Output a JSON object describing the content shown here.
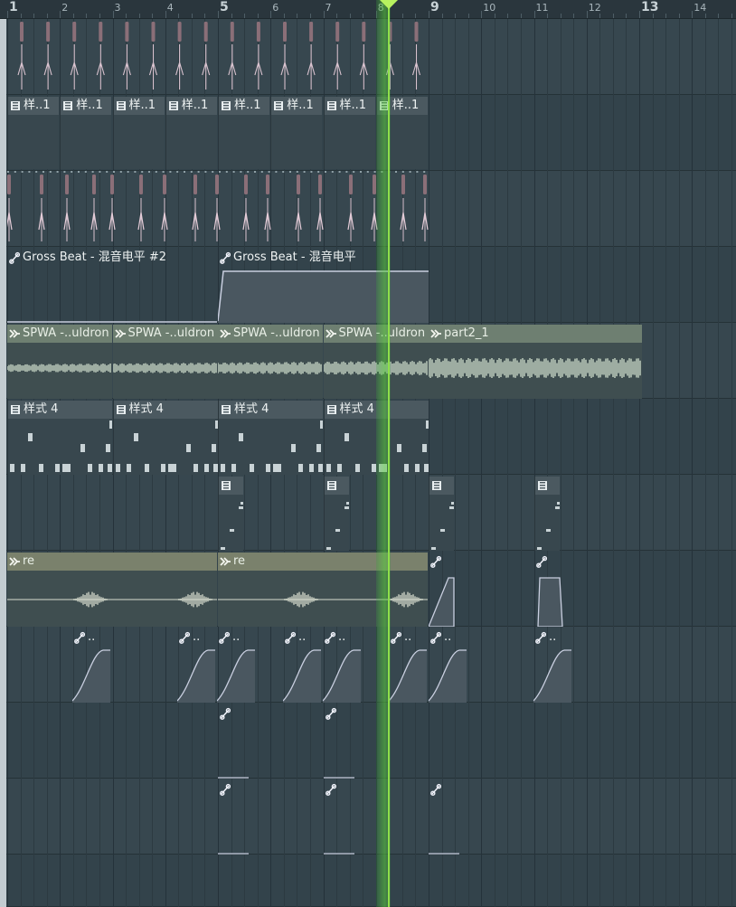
{
  "colors": {
    "background": "#34444d",
    "ruler": "#2a363d",
    "pattern_header": "#4b5960",
    "audio_header": "#6e7f71",
    "automation_header": "#59628a",
    "playhead": "#8ee04a",
    "waveform": "#c7d6c6"
  },
  "ruler": {
    "bars": [
      "1",
      "2",
      "3",
      "4",
      "5",
      "6",
      "7",
      "8",
      "9",
      "10",
      "11",
      "12",
      "13",
      "14"
    ],
    "major_bars": [
      "1",
      "5",
      "9",
      "13"
    ]
  },
  "playhead": {
    "bar": "8.2",
    "color": "#8ee04a"
  },
  "clips": {
    "row1": {
      "type": "pattern",
      "labels": []
    },
    "row2": {
      "type": "pattern",
      "labels": [
        "样..1",
        "样..1",
        "样..1",
        "样..1",
        "样..1",
        "样..1",
        "样..1",
        "样..1"
      ]
    },
    "row3": {
      "type": "pattern",
      "labels": []
    },
    "row4": {
      "type": "automation",
      "labels": [
        "Gross Beat - 混音电平 #2",
        "Gross Beat - 混音电平"
      ]
    },
    "row5": {
      "type": "audio",
      "labels": [
        "SPWA -..uldron",
        "SPWA -..uldron",
        "SPWA -..uldron",
        "SPWA -..uldron",
        "part2_1"
      ]
    },
    "row6": {
      "type": "pattern",
      "labels": [
        "样式 4",
        "样式 4",
        "样式 4",
        "样式 4"
      ]
    },
    "row7": {
      "type": "pattern",
      "labels": [
        "",
        "",
        "",
        ""
      ]
    },
    "row8": {
      "type": "audio",
      "labels": [
        "re",
        "re"
      ]
    },
    "row9": {
      "type": "automation",
      "labels": [
        "..",
        "..",
        "..",
        "..",
        "..",
        "..",
        "..",
        ".."
      ]
    },
    "row10": {
      "type": "automation",
      "labels": []
    },
    "row11": {
      "type": "automation",
      "labels": []
    }
  },
  "icons": {
    "pattern": "pattern-icon",
    "audio": "audio-clip-icon",
    "automation": "automation-icon",
    "playhead": "playhead-marker-icon"
  }
}
